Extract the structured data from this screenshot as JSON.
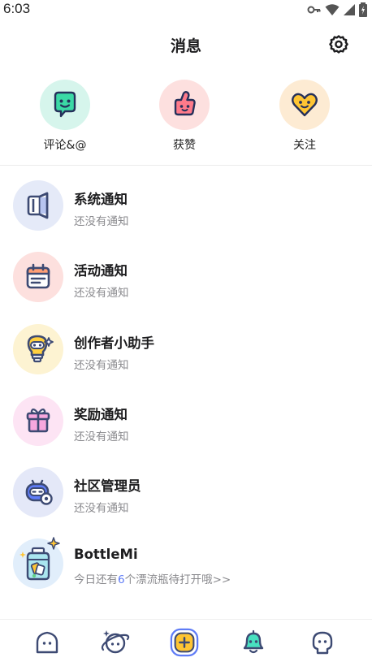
{
  "status": {
    "time": "6:03"
  },
  "header": {
    "title": "消息"
  },
  "quick": [
    {
      "label": "评论&@",
      "icon": "comment-face-icon",
      "bg": "#d6f5ec"
    },
    {
      "label": "获赞",
      "icon": "thumbs-up-icon",
      "bg": "#fde0df"
    },
    {
      "label": "关注",
      "icon": "heart-face-icon",
      "bg": "#fdebd3"
    }
  ],
  "messages": [
    {
      "title": "系统通知",
      "sub": "还没有通知",
      "icon": "speaker-icon",
      "bg": "#e5eaf8"
    },
    {
      "title": "活动通知",
      "sub": "还没有通知",
      "icon": "calendar-icon",
      "bg": "#fde0de"
    },
    {
      "title": "创作者小助手",
      "sub": "还没有通知",
      "icon": "bulb-robot-icon",
      "bg": "#fdf3d2"
    },
    {
      "title": "奖励通知",
      "sub": "还没有通知",
      "icon": "gift-icon",
      "bg": "#fde4f4"
    },
    {
      "title": "社区管理员",
      "sub": "还没有通知",
      "icon": "admin-robot-icon",
      "bg": "#e4e8f8"
    },
    {
      "title": "BottleMi",
      "sub_prefix": "今日还有",
      "sub_count": "6",
      "sub_suffix": "个漂流瓶待打开哦>>",
      "icon": "bottle-icon",
      "bg": "#e1eefb"
    }
  ],
  "tabs": [
    {
      "name": "home",
      "icon": "home-icon",
      "active": false
    },
    {
      "name": "discover",
      "icon": "planet-icon",
      "active": false
    },
    {
      "name": "create",
      "icon": "add-icon",
      "active": false
    },
    {
      "name": "messages",
      "icon": "bell-icon",
      "active": true
    },
    {
      "name": "profile",
      "icon": "profile-icon",
      "active": false
    }
  ],
  "colors": {
    "accent": "#5f7cf6",
    "text_secondary": "#8a8a8e",
    "outline": "#3d4a73"
  }
}
